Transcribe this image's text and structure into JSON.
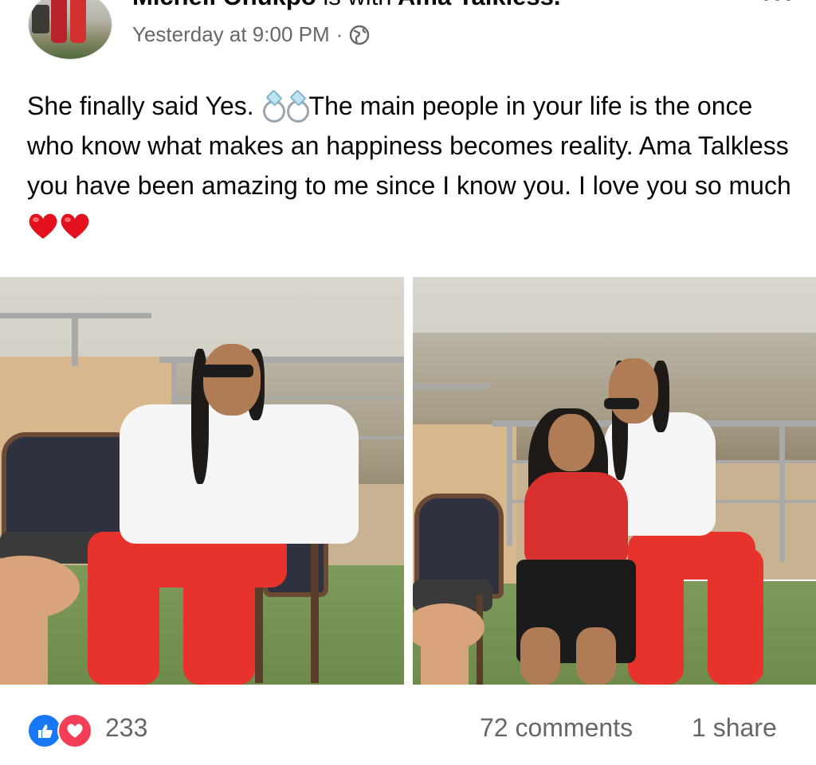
{
  "post": {
    "author": "Michell Ohukpo",
    "with_text": "is with",
    "tagged": "Ama Talkless.",
    "timestamp": "Yesterday at 9:00 PM",
    "separator": "·",
    "privacy_icon": "globe-icon",
    "more_icon": "more-options-icon",
    "text_part1": "She finally said Yes.",
    "text_part2": "The main people in your life is the once who know what makes an happiness becomes reality. Ama Talkless you have been amazing to me since I know you. I love you so much",
    "emojis": [
      "ring-emoji",
      "ring-emoji",
      "red-heart-emoji",
      "red-heart-emoji"
    ]
  },
  "photos": [
    {
      "name": "photo-person-seated-alone"
    },
    {
      "name": "photo-couple-seated"
    }
  ],
  "footer": {
    "reaction_icons": [
      "like-icon",
      "love-icon"
    ],
    "reaction_count": "233",
    "comments": "72 comments",
    "shares": "1 share"
  },
  "colors": {
    "like_blue": "#1877f2",
    "love_red": "#f33e58",
    "secondary_text": "#65676b",
    "primary_text": "#050505"
  }
}
